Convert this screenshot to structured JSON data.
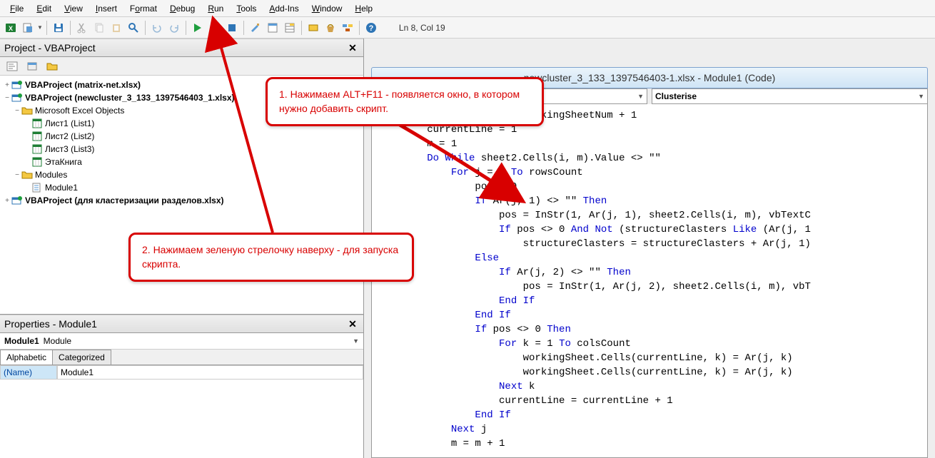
{
  "menu": {
    "file": "File",
    "edit": "Edit",
    "view": "View",
    "insert": "Insert",
    "format": "Format",
    "debug": "Debug",
    "run": "Run",
    "tools": "Tools",
    "addins": "Add-Ins",
    "window": "Window",
    "help": "Help"
  },
  "toolbar": {
    "status": "Ln 8, Col 19"
  },
  "project_pane": {
    "title": "Project - VBAProject",
    "items": [
      {
        "label": "VBAProject (matrix-net.xlsx)",
        "bold": true,
        "indent": 0,
        "tw": "+"
      },
      {
        "label": "VBAProject (newcluster_3_133_1397546403_1.xlsx)",
        "bold": true,
        "indent": 0,
        "tw": "−"
      },
      {
        "label": "Microsoft Excel Objects",
        "indent": 1,
        "tw": "−",
        "folder": true
      },
      {
        "label": "Лист1 (List1)",
        "indent": 2,
        "sheet": true
      },
      {
        "label": "Лист2 (List2)",
        "indent": 2,
        "sheet": true
      },
      {
        "label": "Лист3 (List3)",
        "indent": 2,
        "sheet": true
      },
      {
        "label": "ЭтаКнига",
        "indent": 2,
        "sheet": true
      },
      {
        "label": "Modules",
        "indent": 1,
        "tw": "−",
        "folder": true
      },
      {
        "label": "Module1",
        "indent": 2,
        "mod": true
      },
      {
        "label": "VBAProject (для кластеризации разделов.xlsx)",
        "bold": true,
        "indent": 0,
        "tw": "+"
      }
    ]
  },
  "properties_pane": {
    "title": "Properties - Module1",
    "obj_name": "Module1",
    "obj_type": "Module",
    "tab_alpha": "Alphabetic",
    "tab_cat": "Categorized",
    "prop_key": "(Name)",
    "prop_val": "Module1"
  },
  "code_pane": {
    "title": "newcluster_3_133_1397546403-1.xlsx - Module1 (Code)",
    "dd_left": "",
    "dd_right": "Clusterise",
    "lines": [
      {
        "t": "etNum = workingSheetNum + 1",
        "i": 4
      },
      {
        "t": "currentLine = 1",
        "i": 2
      },
      {
        "t": "m = 1",
        "i": 2
      },
      {
        "t": "<kw>Do While</kw> sheet2.Cells(i, m).Value <> \"\"",
        "i": 2
      },
      {
        "t": "<kw>For</kw> j = 1 <kw>To</kw> rowsCount",
        "i": 3
      },
      {
        "t": "pos = 0",
        "i": 4
      },
      {
        "t": "<kw>If</kw> Ar(j, 1) <> \"\" <kw>Then</kw>",
        "i": 4
      },
      {
        "t": "pos = InStr(1, Ar(j, 1), sheet2.Cells(i, m), vbTextC",
        "i": 5
      },
      {
        "t": "<kw>If</kw> pos <> 0 <kw>And Not</kw> (structureClasters <kw>Like</kw> (Ar(j, 1",
        "i": 5
      },
      {
        "t": "structureClasters = structureClasters + Ar(j, 1)",
        "i": 6
      },
      {
        "t": "<kw>Else</kw>",
        "i": 4
      },
      {
        "t": "<kw>If</kw> Ar(j, 2) <> \"\" <kw>Then</kw>",
        "i": 5
      },
      {
        "t": "pos = InStr(1, Ar(j, 2), sheet2.Cells(i, m), vbT",
        "i": 6
      },
      {
        "t": "<kw>End If</kw>",
        "i": 5
      },
      {
        "t": "<kw>End If</kw>",
        "i": 4
      },
      {
        "t": "<kw>If</kw> pos <> 0 <kw>Then</kw>",
        "i": 4
      },
      {
        "t": "<kw>For</kw> k = 1 <kw>To</kw> colsCount",
        "i": 5
      },
      {
        "t": "workingSheet.Cells(currentLine, k) = Ar(j, k)",
        "i": 6
      },
      {
        "t": "workingSheet.Cells(currentLine, k) = Ar(j, k)",
        "i": 6
      },
      {
        "t": "<kw>Next</kw> k",
        "i": 5
      },
      {
        "t": "currentLine = currentLine + 1",
        "i": 5
      },
      {
        "t": "<kw>End If</kw>",
        "i": 4
      },
      {
        "t": "<kw>Next</kw> j",
        "i": 3
      },
      {
        "t": "m = m + 1",
        "i": 3
      }
    ]
  },
  "callouts": {
    "c1": "1. Нажимаем ALT+F11  - появляется окно, в котором нужно добавить скрипт.",
    "c2": "2.  Нажимаем зеленую стрелочку наверху - для запуска скрипта."
  }
}
